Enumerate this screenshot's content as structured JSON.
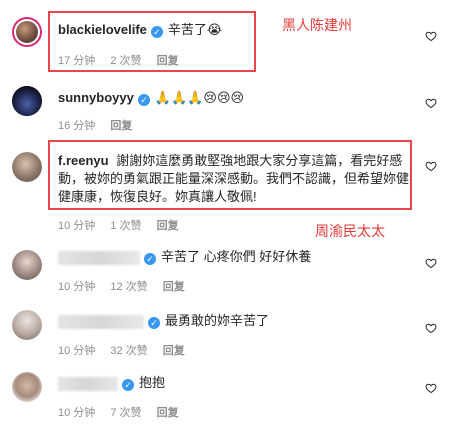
{
  "comments": [
    {
      "username": "blackielovelife",
      "verified": true,
      "text": "辛苦了😭",
      "time": "17 分钟",
      "likes": "2 次赞",
      "reply": "回复"
    },
    {
      "username": "sunnyboyyy",
      "verified": true,
      "text": "🙏🙏🙏😢😢😢",
      "time": "16 分钟",
      "reply": "回复"
    },
    {
      "username": "f.reenyu",
      "verified": false,
      "text": "謝謝妳這麼勇敢堅強地跟大家分享這篇，看完好感動，被妳的勇氣跟正能量深深感動。我們不認識，但希望妳健健康康，恢復良好。妳真讓人敬佩!",
      "time": "10 分钟",
      "likes": "1 次赞",
      "reply": "回复"
    },
    {
      "username_hidden": true,
      "verified": true,
      "text": "辛苦了 心疼你們 好好休養",
      "time": "10 分钟",
      "likes": "12 次赞",
      "reply": "回复"
    },
    {
      "username_hidden": true,
      "verified": true,
      "text": "最勇敢的妳辛苦了",
      "time": "10 分钟",
      "likes": "32 次赞",
      "reply": "回复"
    },
    {
      "username_hidden": true,
      "verified": true,
      "text": "抱抱",
      "time": "10 分钟",
      "likes": "7 次赞",
      "reply": "回复"
    }
  ],
  "annotations": {
    "label_1": "黑人陈建州",
    "label_2": "周渝民太太",
    "color": "#e8464b"
  },
  "icons": {
    "verified": "verified-check-icon",
    "like": "heart-outline-icon"
  }
}
